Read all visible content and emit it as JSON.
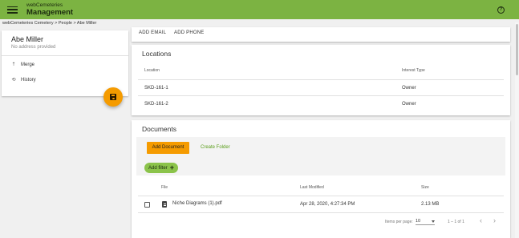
{
  "header": {
    "brand_top": "webCemeteries",
    "brand_main": "Management",
    "help_glyph": "?"
  },
  "breadcrumb": "webCemeteries Cemetery > People > Abe Miller",
  "person": {
    "name": "Abe Miller",
    "address": "No address provided",
    "menu": [
      {
        "label": "Merge",
        "icon": "merge-icon",
        "glyph": "⇡"
      },
      {
        "label": "History",
        "icon": "history-icon",
        "glyph": "⟲"
      }
    ]
  },
  "actions": {
    "add_email": "ADD EMAIL",
    "add_phone": "ADD PHONE"
  },
  "locations": {
    "title": "Locations",
    "columns": [
      "Location",
      "Interest Type"
    ],
    "rows": [
      {
        "location": "SKD-161-1",
        "interest": "Owner"
      },
      {
        "location": "SKD-161-2",
        "interest": "Owner"
      }
    ]
  },
  "documents": {
    "title": "Documents",
    "add_document": "Add Document",
    "create_folder": "Create Folder",
    "add_filter": "Add filter",
    "add_filter_glyph": "+",
    "columns": [
      "File",
      "Last Modified",
      "Size"
    ],
    "rows": [
      {
        "file": "Niche Diagrams (1).pdf",
        "modified": "Apr 28, 2020, 4:27:34 PM",
        "size": "2.13 MB"
      }
    ],
    "pager": {
      "items_label": "Items per page:",
      "per_page": "10",
      "range": "1 – 1 of 1",
      "prev_glyph": "‹",
      "next_glyph": "›"
    }
  },
  "colors": {
    "topbar": "#7cb342",
    "accent": "#f59b00",
    "filter": "#8bc34a",
    "link": "#5a9e1b"
  }
}
